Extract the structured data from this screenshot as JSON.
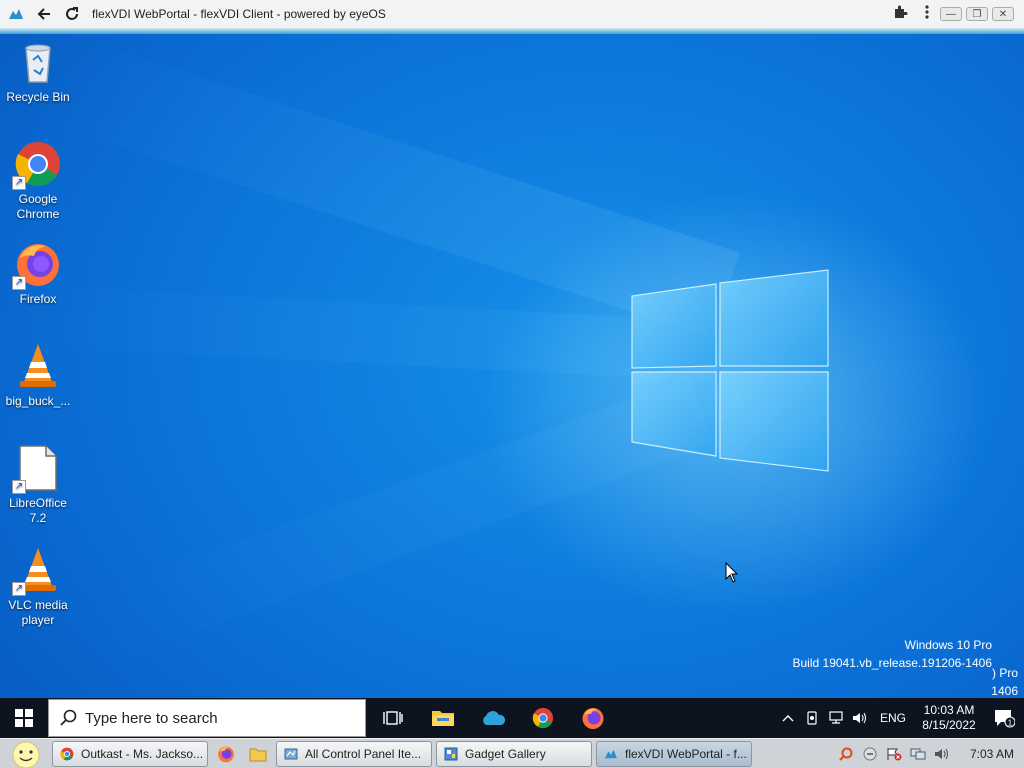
{
  "browser": {
    "title": "flexVDI WebPortal - flexVDI Client - powered by eyeOS",
    "icons": [
      "flexvdi-icon",
      "back-icon",
      "reload-icon",
      "extensions-icon",
      "menu-icon"
    ],
    "window_controls": [
      "minimize",
      "restore",
      "close"
    ]
  },
  "desktop": {
    "icons": [
      {
        "name": "recycle-bin",
        "label": "Recycle Bin"
      },
      {
        "name": "google-chrome",
        "label": "Google Chrome"
      },
      {
        "name": "firefox",
        "label": "Firefox"
      },
      {
        "name": "big-buck-bunny",
        "label": "big_buck_..."
      },
      {
        "name": "libreoffice",
        "label": "LibreOffice 7.2"
      },
      {
        "name": "vlc",
        "label": "VLC media player"
      }
    ],
    "watermark": {
      "line1": "Windows 10 Pro",
      "line2": "Build 19041.vb_release.191206-1406"
    },
    "edge_text": {
      "line1": ") Pro",
      "line2": "1406"
    }
  },
  "taskbar": {
    "search_placeholder": "Type here to search",
    "pinned": [
      "task-view",
      "file-explorer",
      "onedrive",
      "chrome",
      "firefox"
    ],
    "tray": {
      "language": "ENG",
      "time": "10:03 AM",
      "date": "8/15/2022",
      "notification_count": "1"
    }
  },
  "host_taskbar": {
    "tasks": [
      {
        "label": "Outkast - Ms. Jackso...",
        "icon": "chrome-icon"
      },
      {
        "label": "All Control Panel Ite...",
        "icon": "control-panel-icon"
      },
      {
        "label": "Gadget Gallery",
        "icon": "gadget-icon"
      },
      {
        "label": "flexVDI WebPortal - f...",
        "icon": "flexvdi-icon",
        "active": true
      }
    ],
    "clock": "7:03 AM"
  }
}
